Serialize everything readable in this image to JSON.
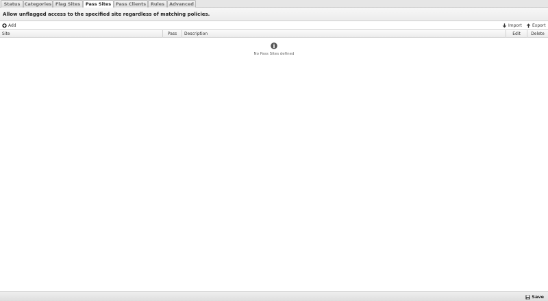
{
  "tabs": [
    {
      "label": "Status",
      "active": false
    },
    {
      "label": "Categories",
      "active": false
    },
    {
      "label": "Flag Sites",
      "active": false
    },
    {
      "label": "Pass Sites",
      "active": true
    },
    {
      "label": "Pass Clients",
      "active": false
    },
    {
      "label": "Rules",
      "active": false
    },
    {
      "label": "Advanced",
      "active": false
    }
  ],
  "description": "Allow unflagged access to the specified site regardless of matching policies.",
  "toolbar": {
    "add_label": "Add",
    "import_label": "Import",
    "export_label": "Export"
  },
  "grid": {
    "columns": [
      "Site",
      "Pass",
      "Description",
      "Edit",
      "Delete"
    ],
    "empty_message": "No Pass Sites defined"
  },
  "footer": {
    "save_label": "Save"
  },
  "icons": {
    "add": "add-circle-icon",
    "import": "arrow-down-icon",
    "export": "arrow-up-icon",
    "info": "info-icon",
    "save": "floppy-disk-icon"
  },
  "colors": {
    "tab_bar_bg": "#e6e6e6",
    "active_tab_bg": "#ffffff",
    "footer_bg": "#e4e4e4",
    "text_dark": "#222222"
  }
}
